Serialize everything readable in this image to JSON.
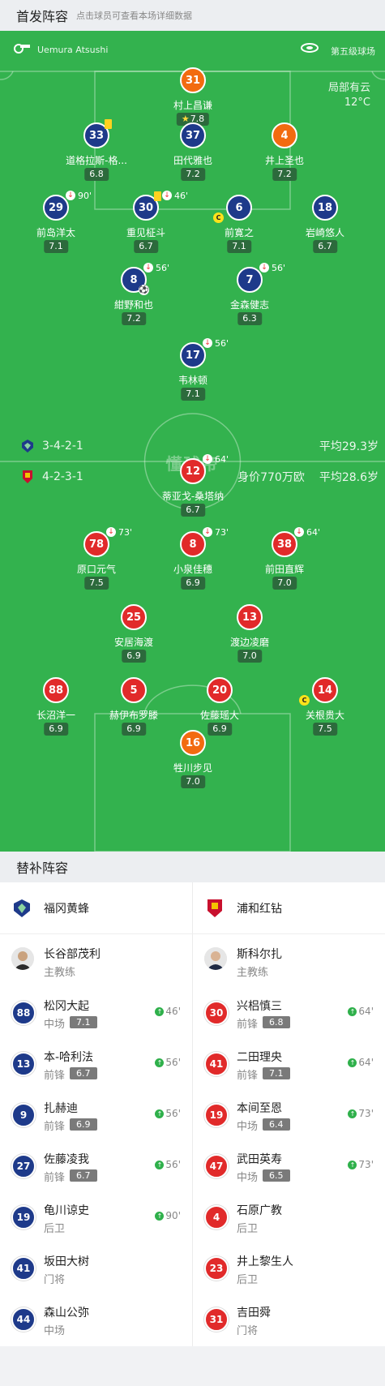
{
  "starting_header": {
    "title": "首发阵容",
    "subtitle": "点击球员可查看本场详细数据"
  },
  "match_info": {
    "referee": "Uemura Atsushi",
    "stadium": "第五级球场",
    "weather": "局部有云",
    "temperature": "12°C",
    "watermark": "懂球帝"
  },
  "home": {
    "name": "福冈黄蜂",
    "color": "#1e3a8a",
    "formation": "3-4-2-1",
    "avg_age": "平均29.3岁",
    "players": [
      {
        "number": "31",
        "name": "村上昌谦",
        "rating": "7.8",
        "style": "orange",
        "star": true
      },
      {
        "number": "33",
        "name": "道格拉斯-格...",
        "rating": "6.8",
        "style": "blue",
        "yellow": true
      },
      {
        "number": "37",
        "name": "田代雅也",
        "rating": "7.2",
        "style": "blue"
      },
      {
        "number": "4",
        "name": "井上圣也",
        "rating": "7.2",
        "style": "orange"
      },
      {
        "number": "29",
        "name": "前岛洋太",
        "rating": "7.1",
        "style": "blue",
        "sub_out": "90'"
      },
      {
        "number": "30",
        "name": "重见柾斗",
        "rating": "6.7",
        "style": "blue",
        "sub_out": "46'",
        "yellow": true
      },
      {
        "number": "6",
        "name": "前寛之",
        "rating": "7.1",
        "style": "blue",
        "captain": true
      },
      {
        "number": "18",
        "name": "岩崎悠人",
        "rating": "6.7",
        "style": "blue"
      },
      {
        "number": "8",
        "name": "紺野和也",
        "rating": "7.2",
        "style": "blue",
        "sub_out": "56'",
        "goal": true
      },
      {
        "number": "7",
        "name": "金森健志",
        "rating": "6.3",
        "style": "blue",
        "sub_out": "56'"
      },
      {
        "number": "17",
        "name": "韦林顿",
        "rating": "7.1",
        "style": "blue",
        "sub_out": "56'"
      }
    ]
  },
  "away": {
    "name": "浦和红钻",
    "color": "#e12a2a",
    "formation": "4-2-3-1",
    "value": "身价770万欧",
    "avg_age": "平均28.6岁",
    "players": [
      {
        "number": "12",
        "name": "蒂亚戈-桑塔纳",
        "rating": "6.7",
        "style": "red",
        "sub_out": "64'"
      },
      {
        "number": "78",
        "name": "原口元气",
        "rating": "7.5",
        "style": "red",
        "sub_out": "73'"
      },
      {
        "number": "8",
        "name": "小泉佳穗",
        "rating": "6.9",
        "style": "red",
        "sub_out": "73'"
      },
      {
        "number": "38",
        "name": "前田直辉",
        "rating": "7.0",
        "style": "red",
        "sub_out": "64'"
      },
      {
        "number": "25",
        "name": "安居海渡",
        "rating": "6.9",
        "style": "red"
      },
      {
        "number": "13",
        "name": "渡边凌磨",
        "rating": "7.0",
        "style": "red"
      },
      {
        "number": "88",
        "name": "长沼洋一",
        "rating": "6.9",
        "style": "red"
      },
      {
        "number": "5",
        "name": "赫伊布罗滕",
        "rating": "6.9",
        "style": "red"
      },
      {
        "number": "20",
        "name": "佐藤瑶大",
        "rating": "6.9",
        "style": "red"
      },
      {
        "number": "14",
        "name": "关根贵大",
        "rating": "7.5",
        "style": "red",
        "captain": true
      },
      {
        "number": "16",
        "name": "牲川步见",
        "rating": "7.0",
        "style": "orange"
      }
    ]
  },
  "subs_header": {
    "title": "替补阵容"
  },
  "subs": {
    "home_team": "福冈黄蜂",
    "away_team": "浦和红钻",
    "home_coach": {
      "name": "长谷部茂利",
      "role": "主教练"
    },
    "away_coach": {
      "name": "斯科尔扎",
      "role": "主教练"
    },
    "home": [
      {
        "number": "88",
        "name": "松冈大起",
        "pos": "中场",
        "rating": "7.1",
        "in": "46'"
      },
      {
        "number": "13",
        "name": "本-哈利法",
        "pos": "前锋",
        "rating": "6.7",
        "in": "56'"
      },
      {
        "number": "9",
        "name": "扎赫迪",
        "pos": "前锋",
        "rating": "6.9",
        "in": "56'"
      },
      {
        "number": "27",
        "name": "佐藤凌我",
        "pos": "前锋",
        "rating": "6.7",
        "in": "56'"
      },
      {
        "number": "19",
        "name": "龟川谅史",
        "pos": "后卫",
        "rating": "",
        "in": "90'"
      },
      {
        "number": "41",
        "name": "坂田大树",
        "pos": "门将",
        "rating": "",
        "in": ""
      },
      {
        "number": "44",
        "name": "森山公弥",
        "pos": "中场",
        "rating": "",
        "in": ""
      }
    ],
    "away": [
      {
        "number": "30",
        "name": "兴梠慎三",
        "pos": "前锋",
        "rating": "6.8",
        "in": "64'"
      },
      {
        "number": "41",
        "name": "二田理央",
        "pos": "前锋",
        "rating": "7.1",
        "in": "64'"
      },
      {
        "number": "19",
        "name": "本间至恩",
        "pos": "中场",
        "rating": "6.4",
        "in": "73'"
      },
      {
        "number": "47",
        "name": "武田英寿",
        "pos": "中场",
        "rating": "6.5",
        "in": "73'"
      },
      {
        "number": "4",
        "name": "石原广教",
        "pos": "后卫",
        "rating": "",
        "in": ""
      },
      {
        "number": "23",
        "name": "井上黎生人",
        "pos": "后卫",
        "rating": "",
        "in": ""
      },
      {
        "number": "31",
        "name": "吉田舜",
        "pos": "门将",
        "rating": "",
        "in": ""
      }
    ]
  }
}
